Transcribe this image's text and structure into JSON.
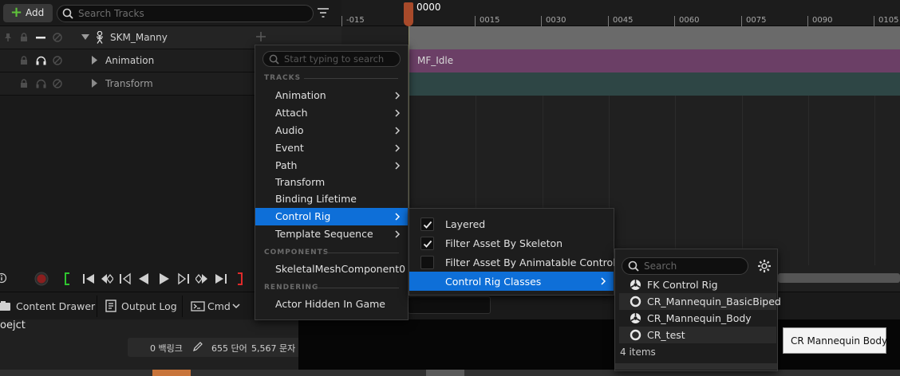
{
  "toolbar": {
    "add_label": "Add",
    "search_placeholder": "Search Tracks"
  },
  "tracks": [
    {
      "label": "SKM_Manny"
    },
    {
      "label": "Animation"
    },
    {
      "label": "Transform"
    }
  ],
  "timeline": {
    "current_frame": "0000",
    "ticks": [
      "-015",
      "0015",
      "0030",
      "0045",
      "0060",
      "0075",
      "0090",
      "0105"
    ],
    "animation_section": "MF_Idle"
  },
  "bottombar": {
    "content_drawer": "Content Drawer",
    "output_log": "Output Log",
    "cmd": "Cmd"
  },
  "output": {
    "text": "oejct",
    "backlinks": "0 백링크",
    "words": "655 단어",
    "chars": "5,567 문자"
  },
  "menu1": {
    "search_placeholder": "Start typing to search",
    "sections": {
      "tracks": "TRACKS",
      "components": "COMPONENTS",
      "rendering": "RENDERING"
    },
    "items": [
      {
        "label": "Animation"
      },
      {
        "label": "Attach"
      },
      {
        "label": "Audio"
      },
      {
        "label": "Event"
      },
      {
        "label": "Path"
      },
      {
        "label": "Transform"
      },
      {
        "label": "Binding Lifetime"
      },
      {
        "label": "Control Rig"
      },
      {
        "label": "Template Sequence"
      }
    ],
    "component_item": "SkeletalMeshComponent0",
    "rendering_item": "Actor Hidden In Game"
  },
  "menu2": {
    "items": [
      {
        "label": "Layered",
        "checked": true
      },
      {
        "label": "Filter Asset By Skeleton",
        "checked": true
      },
      {
        "label": "Filter Asset By Animatable Controls",
        "checked": false
      }
    ],
    "classes_label": "Control Rig Classes"
  },
  "menu3": {
    "search_placeholder": "Search",
    "items": [
      {
        "label": "FK Control Rig",
        "icon": "control-rig-icon"
      },
      {
        "label": "CR_Mannequin_BasicBiped",
        "icon": "ring-icon"
      },
      {
        "label": "CR_Mannequin_Body",
        "icon": "control-rig-icon"
      },
      {
        "label": "CR_test",
        "icon": "ring-icon"
      }
    ],
    "count": "4 items"
  },
  "tooltip": "CR Mannequin Body",
  "colors": {
    "accent": "#0e6fd8",
    "animation_track": "#6b3f66",
    "transform_track": "#2e4645",
    "playhead": "#a84a2a"
  }
}
